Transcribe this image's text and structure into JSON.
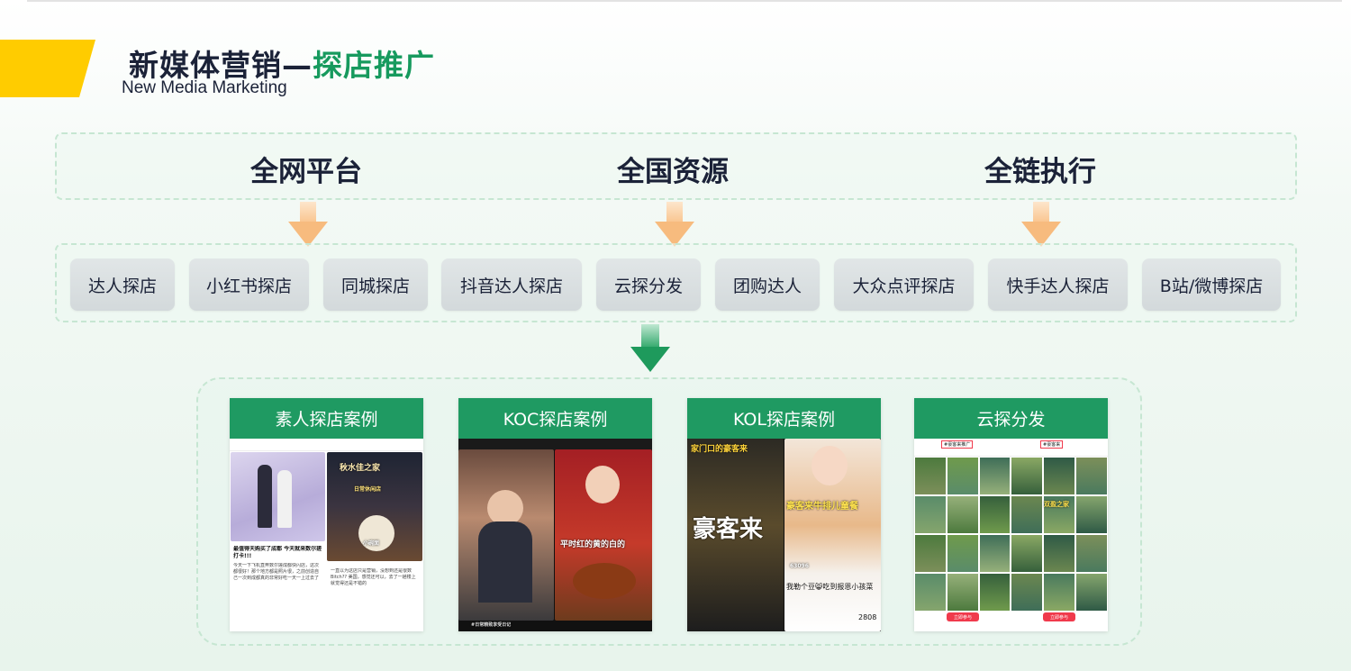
{
  "header": {
    "title_prefix": "新媒体营销—",
    "title_highlight": "探店推广",
    "subtitle": "New Media Marketing",
    "accent_color": "#ffcc00",
    "highlight_color": "#179a5e"
  },
  "pillars": [
    "全网平台",
    "全国资源",
    "全链执行"
  ],
  "channels": [
    "达人探店",
    "小红书探店",
    "同城探店",
    "抖音达人探店",
    "云探分发",
    "团购达人",
    "大众点评探店",
    "快手达人探店",
    "B站/微博探店"
  ],
  "cases": {
    "titles": [
      "素人探店案例",
      "KOC探店案例",
      "KOL探店案例",
      "云探分发"
    ],
    "header_color": "#1f9a62",
    "card1": {
      "sign_text": "秋水佳之家",
      "badge_text": "日常休闲店",
      "menu_text": "小碗面",
      "post_title": "最值得天购买了成都 今天就来数尔搓打卡!!!",
      "post_body": "今天一下飞机直奔数尔搓成都快闪店，这次都很好！那个地方都是照片很，之前创造自己一次到成都真的非常好吃一天一上过去了",
      "post_body2": "一直以为这店只是营销，没想到还是很数Bitch?? 美国，感觉还可以，去了一趟楼上就觉得还是不错的"
    },
    "card2": {
      "overlay_text": "平时红的黄的白的",
      "bottom_text": "#日常精致享受日记"
    },
    "card3": {
      "banner_text": "家门口的豪客来",
      "brand_text": "豪客来",
      "meal_text": "豪客来牛排儿童餐",
      "caption": "我勒个豆😸吃到报恩小孩菜",
      "count": "2808",
      "views": "63096"
    },
    "card4": {
      "tag_left": "#豪客来推广",
      "tag_right": "#豪客来",
      "tile_label": "双盈之家",
      "button_text": "立即参与"
    }
  }
}
